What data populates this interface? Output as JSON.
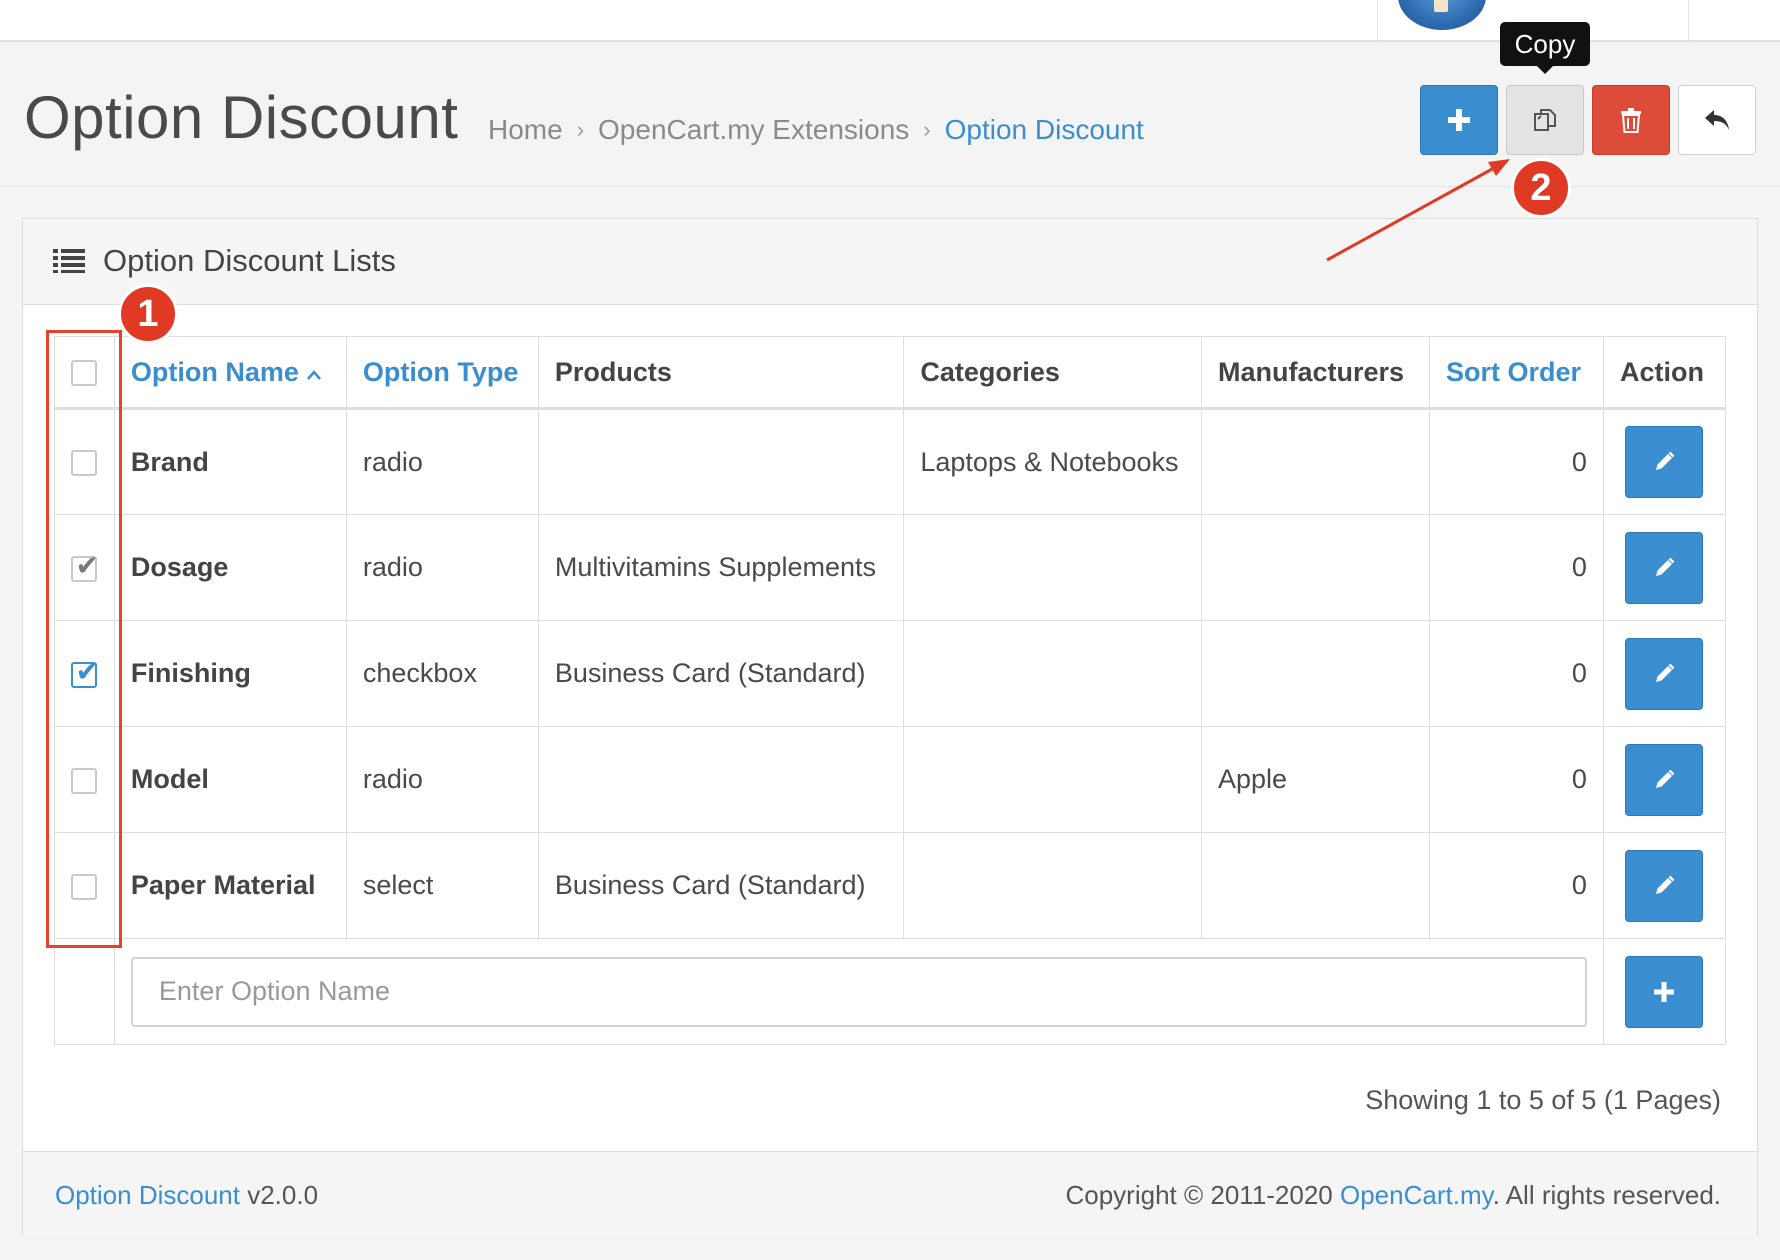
{
  "header": {
    "title": "Option Discount",
    "breadcrumb": [
      "Home",
      "OpenCart.my Extensions",
      "Option Discount"
    ],
    "breadcrumb_separator": "›"
  },
  "toolbar": {
    "buttons": [
      {
        "name": "add-button",
        "icon": "plus-icon",
        "color": "#3a8ed0"
      },
      {
        "name": "copy-button",
        "icon": "copy-icon",
        "color": "#e4e4e4"
      },
      {
        "name": "delete-button",
        "icon": "trash-icon",
        "color": "#dd4b39"
      },
      {
        "name": "back-button",
        "icon": "reply-arrow-icon",
        "color": "#ffffff"
      }
    ],
    "tooltip": "Copy"
  },
  "annotations": {
    "badge_1": "1",
    "badge_2": "2",
    "color": "#e13a24"
  },
  "panel": {
    "title": "Option Discount Lists",
    "icon": "list-icon"
  },
  "table": {
    "columns": {
      "option_name": "Option Name",
      "option_type": "Option Type",
      "products": "Products",
      "categories": "Categories",
      "manufacturers": "Manufacturers",
      "sort_order": "Sort Order",
      "action": "Action"
    },
    "sorted_column": "option_name",
    "sort_direction": "ascending",
    "rows": [
      {
        "checked": false,
        "name": "Brand",
        "type": "radio",
        "products": "",
        "categories": "Laptops & Notebooks",
        "manufacturers": "",
        "sort_order": "0"
      },
      {
        "checked": true,
        "check_style": "gray",
        "name": "Dosage",
        "type": "radio",
        "products": "Multivitamins Supplements",
        "categories": "",
        "manufacturers": "",
        "sort_order": "0"
      },
      {
        "checked": true,
        "check_style": "blue",
        "name": "Finishing",
        "type": "checkbox",
        "products": "Business Card (Standard)",
        "categories": "",
        "manufacturers": "",
        "sort_order": "0"
      },
      {
        "checked": false,
        "name": "Model",
        "type": "radio",
        "products": "",
        "categories": "",
        "manufacturers": "Apple",
        "sort_order": "0"
      },
      {
        "checked": false,
        "name": "Paper Material",
        "type": "select",
        "products": "Business Card (Standard)",
        "categories": "",
        "manufacturers": "",
        "sort_order": "0"
      }
    ],
    "new_option": {
      "placeholder": "Enter Option Name",
      "value": ""
    }
  },
  "pagination": {
    "text": "Showing 1 to 5 of 5 (1 Pages)"
  },
  "footer": {
    "product_link": "Option Discount",
    "version": " v2.0.0",
    "copyright_prefix": "Copyright © 2011-2020 ",
    "company_link": "OpenCart.my",
    "copyright_suffix": ". All rights reserved."
  }
}
